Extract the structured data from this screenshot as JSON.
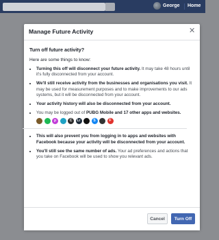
{
  "header": {
    "user_name": "George",
    "home_label": "Home"
  },
  "dialog": {
    "title": "Manage Future Activity",
    "close_icon": "close-icon",
    "question": "Turn off future activity?",
    "intro": "Here are some things to know:",
    "items": [
      {
        "bold": "Turning this off will disconnect your future activity.",
        "text": " It may take 48 hours until it's fully disconnected from your account."
      },
      {
        "bold": "We'll still receive activity from the businesses and organisations you visit.",
        "text": " It may be used for measurement purposes and to make improvements to our ads systems, but it will be disconnected from your account."
      },
      {
        "bold": "Your activity history will also be disconnected from your account.",
        "text": ""
      },
      {
        "pre": "You may be logged out of ",
        "bold": "PUBG Mobile and 17 other apps and websites.",
        "text": ""
      },
      {
        "bold": "This will also prevent you from logging in to apps and websites with Facebook because your activity will be disconnected from your account.",
        "text": ""
      },
      {
        "bold": "You'll still see the same number of ads.",
        "text": " Your ad preferences and actions that you take on Facebook will be used to show you relevant ads."
      }
    ],
    "app_icons": [
      {
        "name": "pubg-app-icon",
        "color": "#7a5a2a",
        "glyph": ""
      },
      {
        "name": "spotify-app-icon",
        "color": "#1db954",
        "glyph": ""
      },
      {
        "name": "picsart-app-icon",
        "color": "#c23ed8",
        "glyph": "p"
      },
      {
        "name": "app-icon-circle",
        "color": "#1fa2c4",
        "glyph": ""
      },
      {
        "name": "app-icon-c",
        "color": "#2d2d2d",
        "glyph": "C"
      },
      {
        "name": "lightroom-app-icon",
        "color": "#1d2b3a",
        "glyph": "Lr"
      },
      {
        "name": "app-icon-black",
        "color": "#111111",
        "glyph": ""
      },
      {
        "name": "shazam-app-icon",
        "color": "#1386f4",
        "glyph": "S"
      },
      {
        "name": "app-icon-dark",
        "color": "#333333",
        "glyph": ""
      },
      {
        "name": "app-icon-red",
        "color": "#e0322d",
        "glyph": "F"
      }
    ],
    "cancel_label": "Cancel",
    "turn_off_label": "Turn Off"
  }
}
